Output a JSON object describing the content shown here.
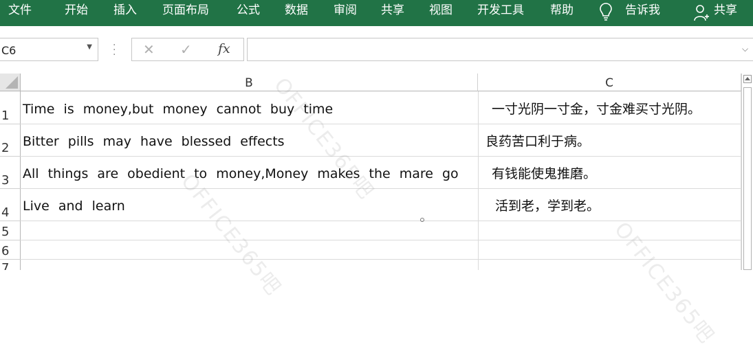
{
  "ribbon": {
    "background": "#217346",
    "tabs": {
      "file": "文件",
      "home": "开始",
      "insert": "插入",
      "page_layout": "页面布局",
      "formulas": "公式",
      "data": "数据",
      "review": "审阅",
      "share_tab": "共享",
      "view": "视图",
      "developer": "开发工具",
      "help": "帮助"
    },
    "tell_me": "告诉我",
    "share_button": "共享"
  },
  "formula_bar": {
    "name_box": "C6",
    "cancel_icon": "✕",
    "enter_icon": "✓",
    "fx_label": "fx",
    "formula_value": ""
  },
  "sheet": {
    "columns": [
      "B",
      "C"
    ],
    "row_numbers": [
      "1",
      "2",
      "3",
      "4",
      "5",
      "6",
      "7"
    ],
    "rows": [
      {
        "b": "Time is money,but money cannot buy time",
        "c": "一寸光阴一寸金，寸金难买寸光阴。"
      },
      {
        "b": "Bitter pills may have blessed effects",
        "c": "良药苦口利于病。"
      },
      {
        "b": "All things are obedient to money,Money makes the mare go",
        "c": "有钱能使鬼推磨。"
      },
      {
        "b": "Live and learn",
        "c": "活到老，学到老。"
      }
    ],
    "watermark": "OFFICE365吧"
  }
}
